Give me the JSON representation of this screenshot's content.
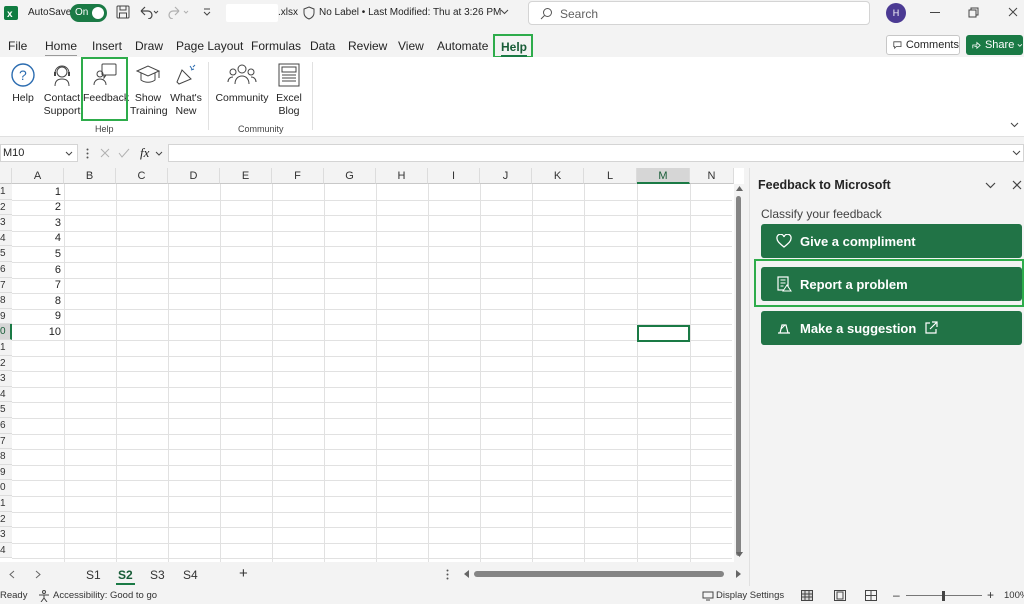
{
  "titlebar": {
    "autosave_label": "AutoSave",
    "autosave_state": "On",
    "file_ext": ".xlsx",
    "label_status": "No Label",
    "last_modified": "Last Modified: Thu at 3:26 PM",
    "search_placeholder": "Search",
    "avatar_initial": "H"
  },
  "tabs": [
    "File",
    "Home",
    "Insert",
    "Draw",
    "Page Layout",
    "Formulas",
    "Data",
    "Review",
    "View",
    "Automate",
    "Help"
  ],
  "actions": {
    "comments": "Comments",
    "share": "Share"
  },
  "ribbon": {
    "buttons": [
      {
        "l1": "Help",
        "l2": ""
      },
      {
        "l1": "Contact",
        "l2": "Support"
      },
      {
        "l1": "Feedback",
        "l2": ""
      },
      {
        "l1": "Show",
        "l2": "Training"
      },
      {
        "l1": "What's",
        "l2": "New"
      },
      {
        "l1": "Community",
        "l2": ""
      },
      {
        "l1": "Excel",
        "l2": "Blog"
      }
    ],
    "groups": [
      "Help",
      "Community"
    ]
  },
  "formula_bar": {
    "name_box": "M10",
    "fx": "fx",
    "formula": ""
  },
  "sheet": {
    "columns": [
      "A",
      "B",
      "C",
      "D",
      "E",
      "F",
      "G",
      "H",
      "I",
      "J",
      "K",
      "L",
      "M",
      "N"
    ],
    "row_labels": [
      "1",
      "2",
      "3",
      "4",
      "5",
      "6",
      "7",
      "8",
      "9",
      "0",
      "1",
      "2",
      "3",
      "4",
      "5",
      "6",
      "7",
      "8",
      "9",
      "0",
      "1",
      "2",
      "3",
      "4"
    ],
    "values_col_a": [
      "1",
      "2",
      "3",
      "4",
      "5",
      "6",
      "7",
      "8",
      "9",
      "10"
    ],
    "selected_column": "M",
    "selected_row_index": 10
  },
  "sheet_tabs": {
    "tabs": [
      "S1",
      "S2",
      "S3",
      "S4"
    ],
    "active": "S2",
    "add": "+"
  },
  "status": {
    "ready": "Ready",
    "accessibility": "Accessibility: Good to go",
    "display_settings": "Display Settings",
    "zoom": "100%"
  },
  "pane": {
    "title": "Feedback to Microsoft",
    "subtitle": "Classify your feedback",
    "buttons": [
      "Give a compliment",
      "Report a problem",
      "Make a suggestion"
    ]
  },
  "colors": {
    "accent": "#1a7a45",
    "button": "#217346",
    "highlight": "#2eac4b"
  }
}
